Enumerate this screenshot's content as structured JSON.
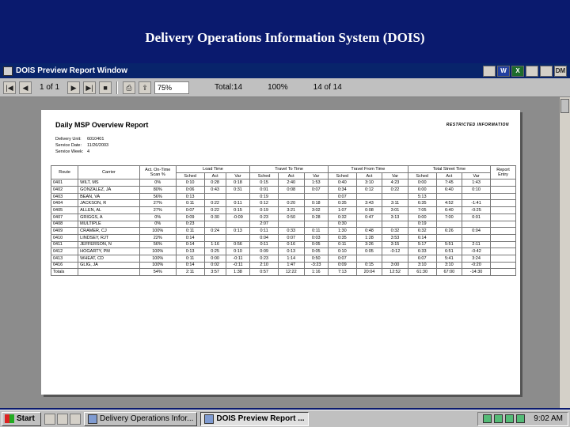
{
  "slide": {
    "title": "Delivery Operations Information System (DOIS)"
  },
  "window": {
    "title": "DOIS Preview Report Window",
    "tray_icons": [
      "W",
      "X",
      "",
      "",
      "DM"
    ]
  },
  "toolbar": {
    "page_info": "1 of 1",
    "zoom": "75%",
    "total": "Total:14",
    "percent": "100%",
    "count": "14 of 14"
  },
  "report": {
    "title": "Daily MSP Overview Report",
    "restricted": "RESTRICTED INFORMATION",
    "meta": [
      {
        "label": "Delivery Unit:",
        "value": "6010401"
      },
      {
        "label": "Service Date:",
        "value": "11/26/2003"
      },
      {
        "label": "Service Week:",
        "value": "4"
      }
    ],
    "group_headers": [
      "Route",
      "Carrier",
      "Act. On-Time Scan %",
      "Load Time",
      "Travel To Time",
      "Travel From Time",
      "Total Street Time",
      "Report Entry"
    ],
    "sub_headers": [
      "Sched",
      "Act",
      "Var",
      "Sched",
      "Act",
      "Var",
      "Sched",
      "Act",
      "Var",
      "Sched",
      "Act",
      "Var"
    ],
    "rows": [
      [
        "0401",
        "WILT, MS",
        "0%",
        "0:10",
        "0:28",
        "0:18",
        "0:15",
        "2:40",
        "1:53",
        "0:40",
        "3:10",
        "4:23",
        "0:00",
        "7:45",
        "1:43",
        ""
      ],
      [
        "0402",
        "GONZALEZ, JA",
        "80%",
        "0:06",
        "0:43",
        "0:31",
        "0:01",
        "0:08",
        "0:07",
        "0:34",
        "0:12",
        "0:22",
        "6:00",
        "6:40",
        "0:10",
        ""
      ],
      [
        "0403",
        "BEAN, VA",
        "56%",
        "0:13",
        "",
        "",
        "0:19",
        "",
        "",
        "0:07",
        "",
        "",
        "5:13",
        "",
        "",
        ""
      ],
      [
        "0404",
        "JACKSON, R",
        "27%",
        "0:11",
        "0:22",
        "0:11",
        "0:12",
        "0:20",
        "0:18",
        "0:35",
        "3:43",
        "3:11",
        "6:35",
        "4:52",
        "-1:41",
        ""
      ],
      [
        "0405",
        "ALLEN, AL",
        "27%",
        "0:07",
        "0:22",
        "0:15",
        "0:19",
        "3:21",
        "3:02",
        "1:07",
        "0:08",
        "3:01",
        "7:05",
        "6:40",
        "-0:25",
        ""
      ],
      [
        "0407",
        "GRIGGS, A",
        "0%",
        "0:09",
        "0:30",
        "-0:09",
        "0:23",
        "0:50",
        "0:28",
        "0:32",
        "0:47",
        "3:13",
        "0:00",
        "7:00",
        "0:01",
        ""
      ],
      [
        "0408",
        "MULTIPLE",
        "0%",
        "0:23",
        "",
        "",
        "2:07",
        "",
        "",
        "0:30",
        "",
        "",
        "0:19",
        "",
        "",
        ""
      ],
      [
        "0409",
        "CRAMER, CJ",
        "100%",
        "0:11",
        "0:24",
        "0:13",
        "0:11",
        "0:33",
        "0:11",
        "1:30",
        "0:48",
        "0:32",
        "6:32",
        "6:26",
        "0:04",
        ""
      ],
      [
        "0410",
        "LINDSEY, RJT",
        "22%",
        "0:14",
        "",
        "",
        "0:04",
        "0:07",
        "0:03",
        "0:35",
        "1:28",
        "3:53",
        "6:14",
        "",
        "",
        ""
      ],
      [
        "0411",
        "JEFFERSON, N",
        "56%",
        "0:14",
        "1:16",
        "0:56",
        "0:11",
        "0:16",
        "0:05",
        "0:11",
        "3:26",
        "3:15",
        "5:17",
        "5:51",
        "2:11",
        ""
      ],
      [
        "0412",
        "HOGARTY, PM",
        "100%",
        "0:13",
        "0:25",
        "0:10",
        "0:09",
        "0:13",
        "0:05",
        "0:10",
        "0:05",
        "-0:12",
        "6:33",
        "6:51",
        "-0:42",
        ""
      ],
      [
        "0413",
        "WHEAT, CD",
        "100%",
        "0:11",
        "0:00",
        "-0:11",
        "0:23",
        "1:14",
        "0:50",
        "0:07",
        "",
        "",
        "6:07",
        "5:41",
        "3:24",
        ""
      ],
      [
        "0416",
        "GLIG, JA",
        "100%",
        "0:14",
        "0:02",
        "-0:11",
        "2:10",
        "1:47",
        "-3:23",
        "0:09",
        "0:15",
        "3:00",
        "3:10",
        "3:10",
        "-0:20",
        ""
      ]
    ],
    "totals": [
      "Totals",
      "",
      "54%",
      "2:11",
      "3:57",
      "1:38",
      "0:57",
      "12:22",
      "1:16",
      "7:13",
      "20:04",
      "12:52",
      "61:30",
      "67:00",
      "-14:30",
      ""
    ]
  },
  "taskbar": {
    "start": "Start",
    "tasks": [
      "Delivery Operations Infor...",
      "DOIS Preview Report ..."
    ],
    "clock": "9:02 AM"
  }
}
